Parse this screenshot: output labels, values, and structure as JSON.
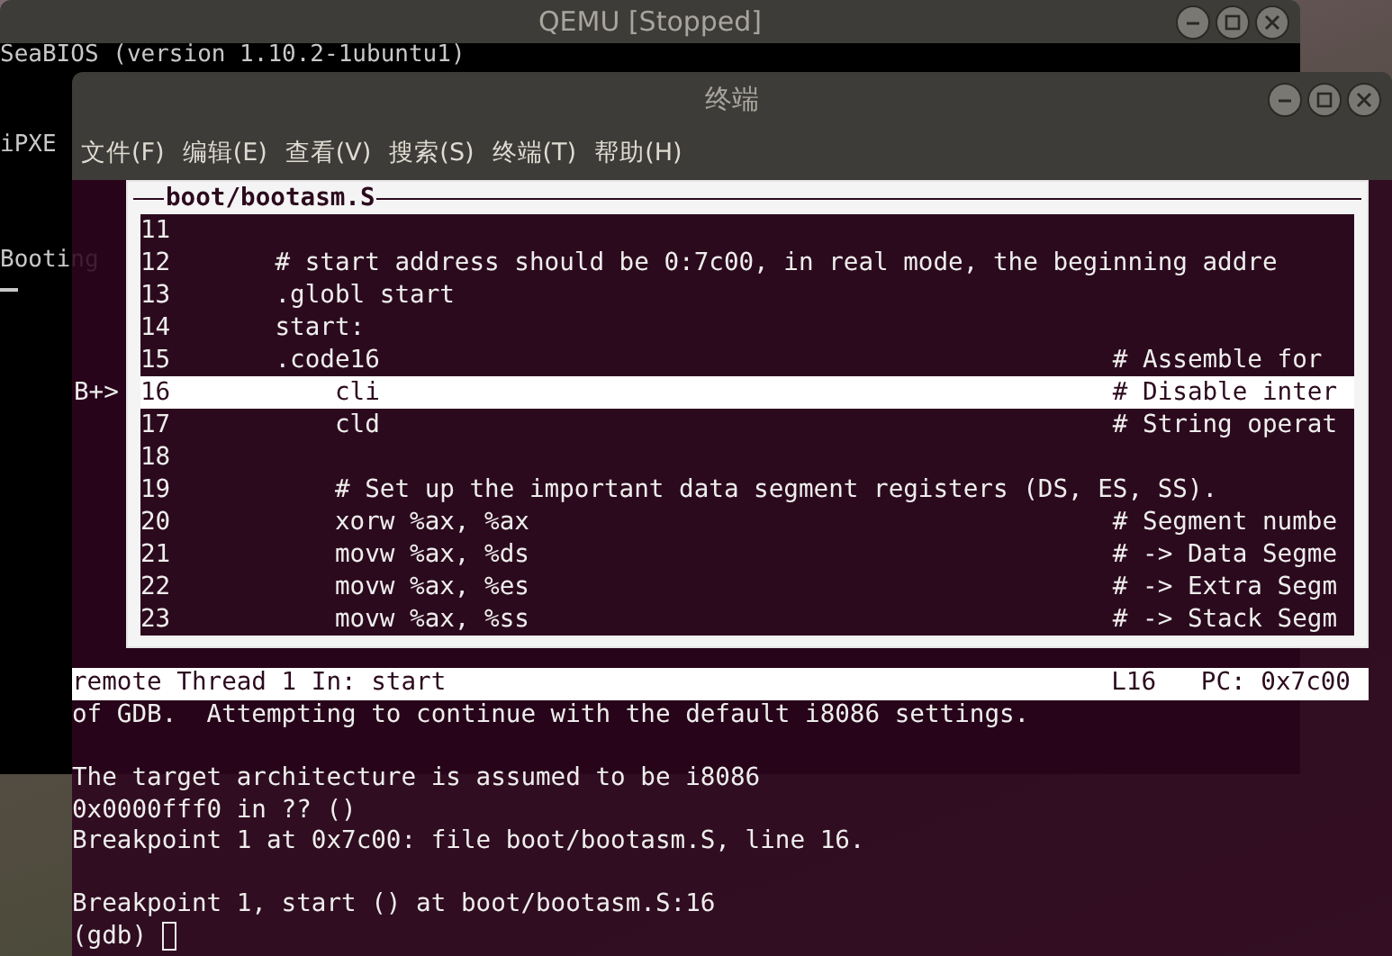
{
  "qemu": {
    "title": "QEMU [Stopped]",
    "screen_lines": [
      "SeaBIOS (version 1.10.2-1ubuntu1)",
      "iPXE",
      "Booting"
    ]
  },
  "terminal": {
    "title": "终端",
    "menu": [
      "文件(F)",
      "编辑(E)",
      "查看(V)",
      "搜索(S)",
      "终端(T)",
      "帮助(H)"
    ],
    "source": {
      "title": "boot/bootasm.S",
      "rows": [
        {
          "num": "11",
          "code": "",
          "comment": "",
          "selected": false
        },
        {
          "num": "12",
          "code": "       # start address should be 0:7c00, in real mode, the beginning addre",
          "comment": "",
          "selected": false
        },
        {
          "num": "13",
          "code": "       .globl start",
          "comment": "",
          "selected": false
        },
        {
          "num": "14",
          "code": "       start:",
          "comment": "",
          "selected": false
        },
        {
          "num": "15",
          "code": "       .code16",
          "comment": "# Assemble for",
          "selected": false
        },
        {
          "num": "16",
          "code": "           cli",
          "comment": "# Disable inter",
          "selected": true,
          "marker": "B+>"
        },
        {
          "num": "17",
          "code": "           cld",
          "comment": "# String operat",
          "selected": false
        },
        {
          "num": "18",
          "code": "",
          "comment": "",
          "selected": false
        },
        {
          "num": "19",
          "code": "           # Set up the important data segment registers (DS, ES, SS).",
          "comment": "",
          "selected": false
        },
        {
          "num": "20",
          "code": "           xorw %ax, %ax",
          "comment": "# Segment numbe",
          "selected": false
        },
        {
          "num": "21",
          "code": "           movw %ax, %ds",
          "comment": "# -> Data Segme",
          "selected": false
        },
        {
          "num": "22",
          "code": "           movw %ax, %es",
          "comment": "# -> Extra Segm",
          "selected": false
        },
        {
          "num": "23",
          "code": "           movw %ax, %ss",
          "comment": "# -> Stack Segm",
          "selected": false
        }
      ]
    },
    "status": {
      "thread": "remote Thread 1 In: start",
      "line": "L16",
      "pc": "PC: 0x7c00"
    },
    "output": [
      [
        "of GDB.  Attempting to continue with the default i8086 settings."
      ],
      [
        "The target architecture is assumed to be i8086",
        "0x0000fff0 in ?? ()",
        "Breakpoint 1 at 0x7c00: file boot/bootasm.S, line 16."
      ],
      [
        "Breakpoint 1, start () at boot/bootasm.S:16"
      ]
    ],
    "prompt": "(gdb)"
  }
}
